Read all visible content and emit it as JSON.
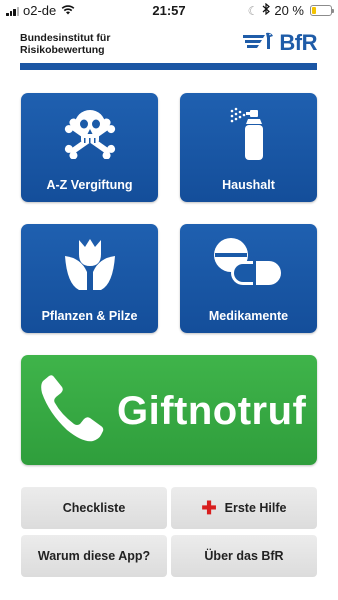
{
  "status_bar": {
    "carrier": "o2-de",
    "time": "21:57",
    "battery_text": "20 %",
    "battery_level": 0.2,
    "battery_color": "#f3c300",
    "icons": [
      "signal-icon",
      "wifi-icon",
      "moon-icon",
      "bluetooth-icon",
      "battery-icon"
    ]
  },
  "header": {
    "institute_line1": "Bundesinstitut für",
    "institute_line2": "Risikobewertung",
    "logo_text": "BfR",
    "brand_color": "#1b56a4"
  },
  "tiles": [
    {
      "label": "A-Z Vergiftung",
      "icon": "skull-crossbones-icon"
    },
    {
      "label": "Haushalt",
      "icon": "spray-can-icon"
    },
    {
      "label": "Pflanzen & Pilze",
      "icon": "tulip-icon"
    },
    {
      "label": "Medikamente",
      "icon": "pills-icon"
    }
  ],
  "emergency": {
    "label": "Giftnotruf",
    "icon": "phone-icon",
    "color": "#36a843"
  },
  "buttons": {
    "checkliste": "Checkliste",
    "erste_hilfe": "Erste Hilfe",
    "warum": "Warum diese App?",
    "ueber": "Über das BfR"
  }
}
